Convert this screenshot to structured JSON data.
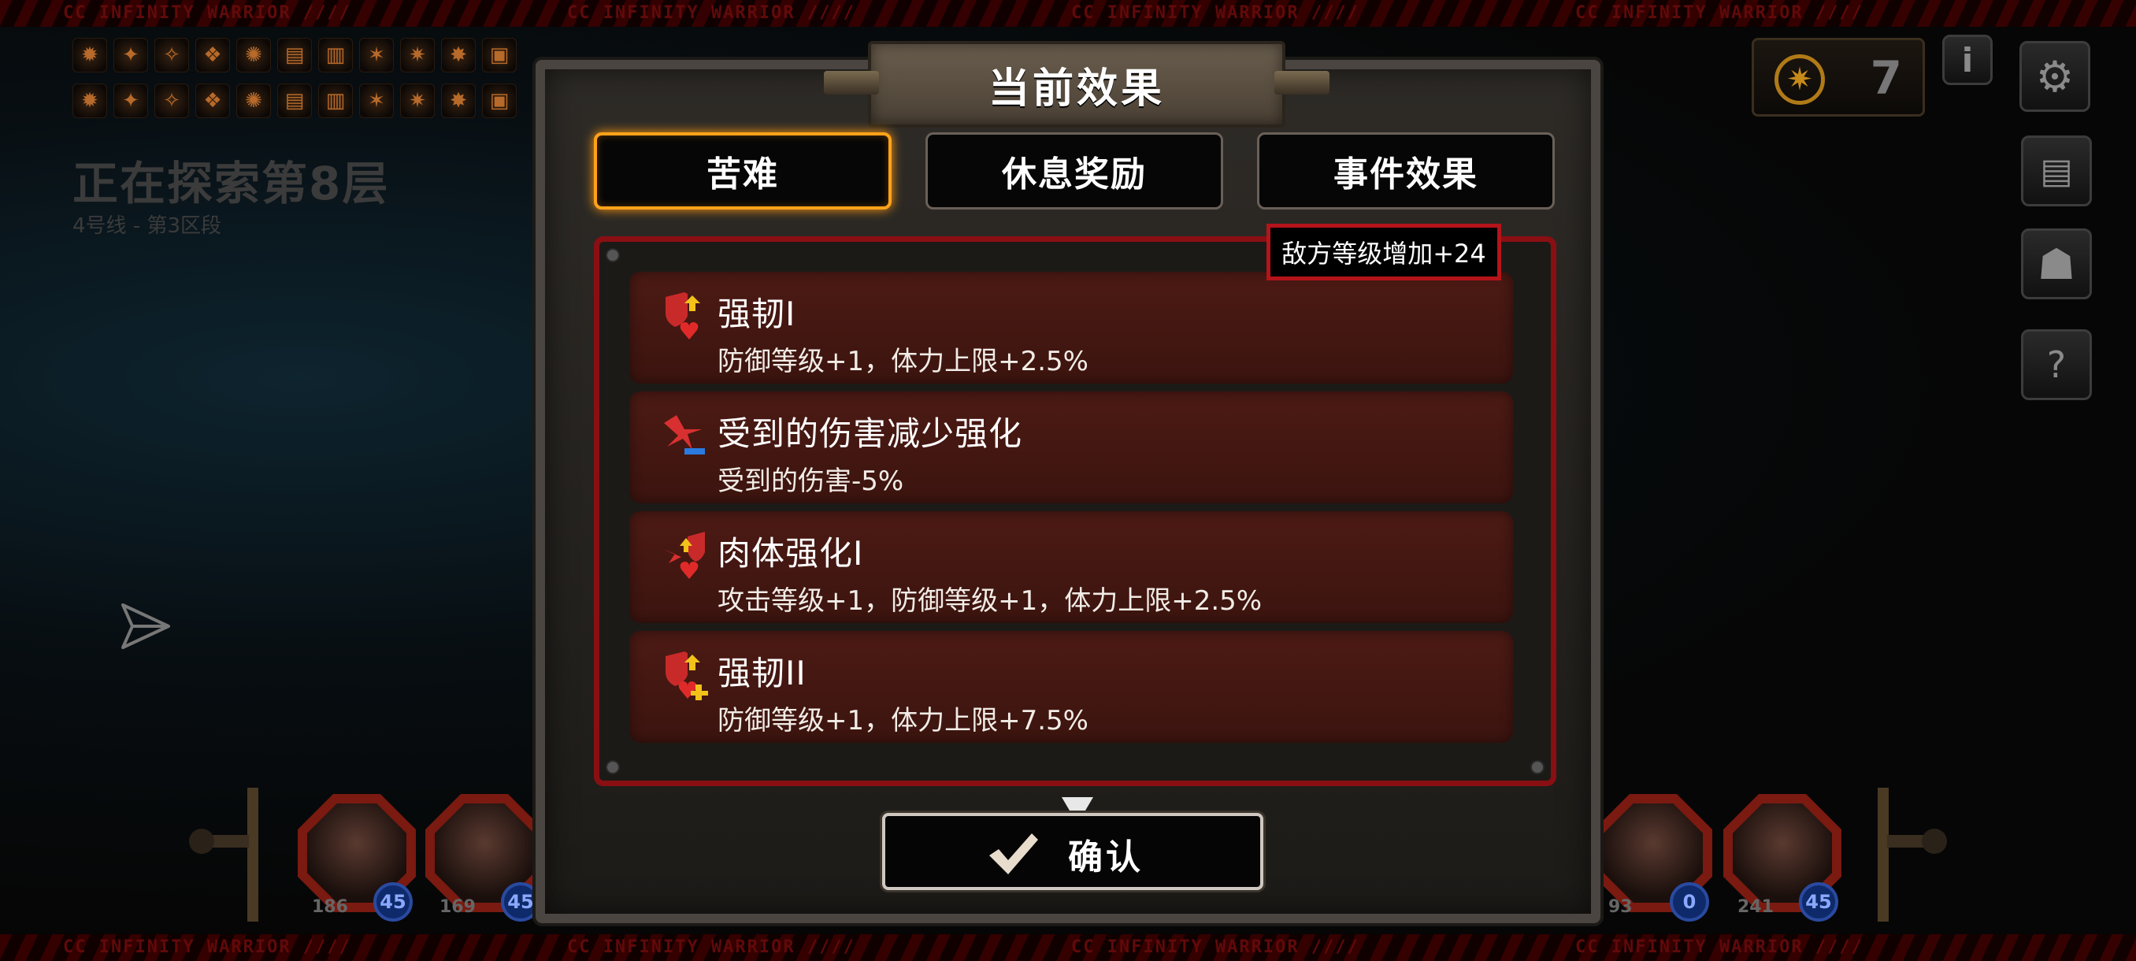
{
  "hud": {
    "explore_title": "正在探索第8层",
    "explore_subtitle": "4号线 - 第3区段",
    "gold_value": "7",
    "hazard_text": "CC INFINITY WARRIOR ////",
    "inventory_icons": [
      "item-icon",
      "item-icon",
      "item-icon",
      "item-icon",
      "item-icon",
      "item-icon",
      "item-icon",
      "item-icon",
      "item-icon",
      "item-icon",
      "item-icon",
      "item-icon",
      "item-icon",
      "item-icon",
      "item-icon",
      "item-icon",
      "item-icon",
      "item-icon",
      "item-icon",
      "item-icon",
      "item-icon",
      "item-icon"
    ]
  },
  "party": [
    {
      "hp": "186",
      "level": "45"
    },
    {
      "hp": "169",
      "level": "45"
    },
    {
      "hp": "93",
      "level": "0"
    },
    {
      "hp": "241",
      "level": "45"
    }
  ],
  "modal": {
    "title": "当前效果",
    "tabs": [
      "苦难",
      "休息奖励",
      "事件效果"
    ],
    "active_tab": "苦难",
    "enemy_badge": "敌方等级增加+24",
    "effects": [
      {
        "name": "强韧I",
        "desc": "防御等级+1，体力上限+2.5%",
        "icon": "shield-heart-up-icon"
      },
      {
        "name": "受到的伤害减少强化",
        "desc": "受到的伤害-5%",
        "icon": "damage-reduce-icon"
      },
      {
        "name": "肉体强化I",
        "desc": "攻击等级+1，防御等级+1，体力上限+2.5%",
        "icon": "body-enhance-icon"
      },
      {
        "name": "强韧II",
        "desc": "防御等级+1，体力上限+7.5%",
        "icon": "shield-heart-plus-icon"
      }
    ],
    "confirm_label": "确认"
  },
  "colors": {
    "accent_orange": "#ffa21a",
    "frame_red": "#8a0f12",
    "badge_red": "#b4141a",
    "effect_bg": "#4c1a14"
  }
}
